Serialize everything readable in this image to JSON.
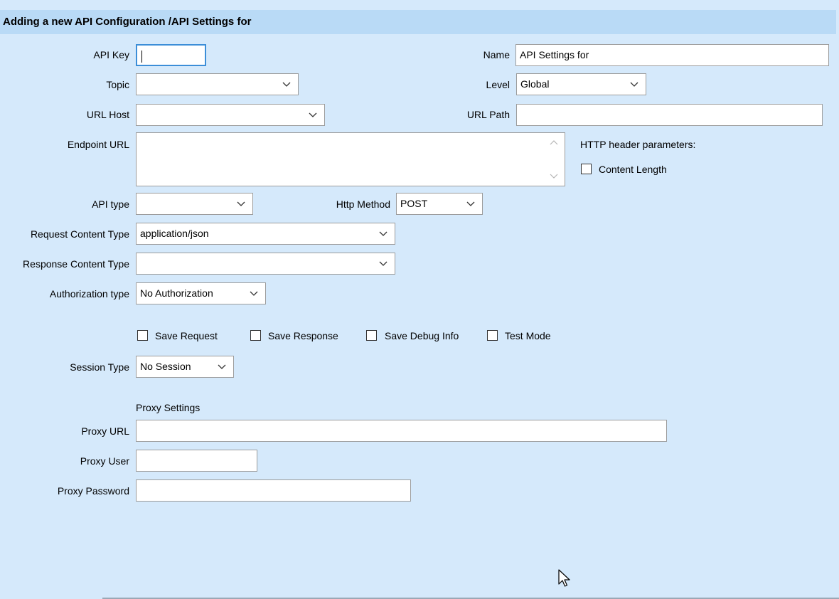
{
  "header": {
    "title": "Adding a new API Configuration /API Settings for"
  },
  "fields": {
    "api_key": {
      "label": "API Key",
      "value": ""
    },
    "name": {
      "label": "Name",
      "value": "API Settings for"
    },
    "topic": {
      "label": "Topic",
      "value": ""
    },
    "level": {
      "label": "Level",
      "value": "Global"
    },
    "url_host": {
      "label": "URL Host",
      "value": ""
    },
    "url_path": {
      "label": "URL Path",
      "value": ""
    },
    "endpoint_url": {
      "label": "Endpoint URL",
      "value": ""
    },
    "http_header": {
      "label": "HTTP header parameters:",
      "content_length": "Content Length"
    },
    "api_type": {
      "label": "API type",
      "value": ""
    },
    "http_method": {
      "label": "Http Method",
      "value": "POST"
    },
    "request_content_type": {
      "label": "Request Content Type",
      "value": "application/json"
    },
    "response_content_type": {
      "label": "Response Content Type",
      "value": ""
    },
    "authorization_type": {
      "label": "Authorization type",
      "value": "No Authorization"
    },
    "session_type": {
      "label": "Session Type",
      "value": "No Session"
    }
  },
  "options": {
    "save_request": "Save Request",
    "save_response": "Save Response",
    "save_debug_info": "Save Debug Info",
    "test_mode": "Test Mode"
  },
  "proxy": {
    "section_title": "Proxy Settings",
    "url": {
      "label": "Proxy URL",
      "value": ""
    },
    "user": {
      "label": "Proxy User",
      "value": ""
    },
    "password": {
      "label": "Proxy Password",
      "value": ""
    }
  },
  "icons": {
    "dropdown": "chevron-down-icon",
    "cursor": "mouse-pointer-icon"
  },
  "colors": {
    "background": "#d5e9fb",
    "header": "#b9daf6",
    "focus": "#3c8ed8"
  }
}
